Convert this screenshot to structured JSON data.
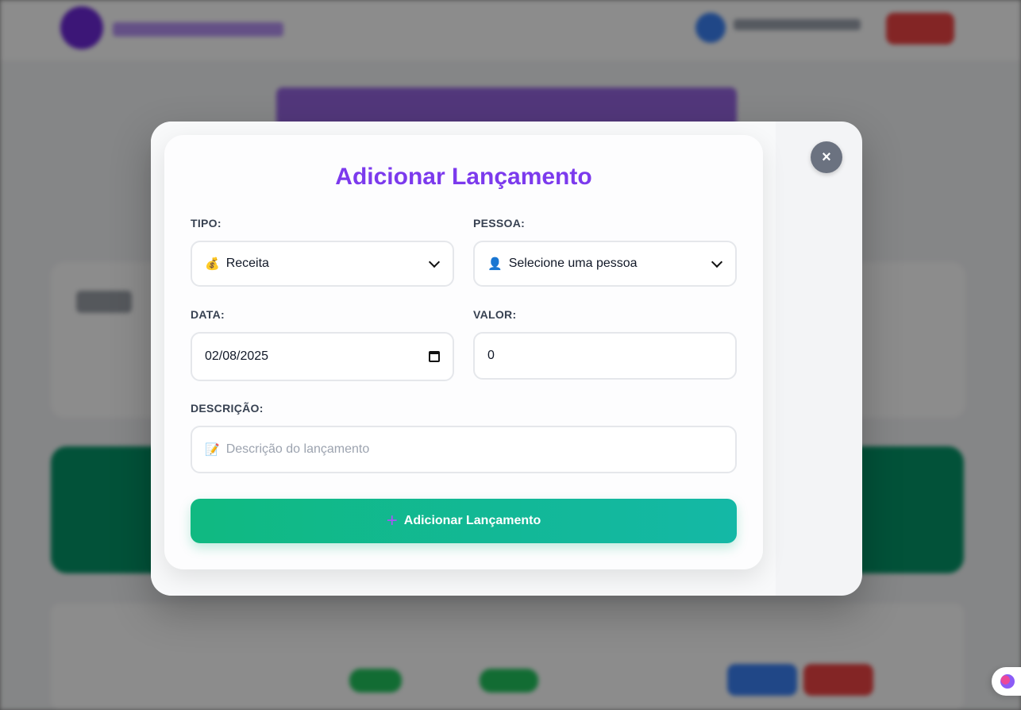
{
  "modal": {
    "title": "Adicionar Lançamento",
    "close_label": "×"
  },
  "form": {
    "tipo": {
      "label": "TIPO:",
      "icon": "💰",
      "value": "Receita"
    },
    "pessoa": {
      "label": "PESSOA:",
      "icon": "👤",
      "value": "Selecione uma pessoa"
    },
    "data": {
      "label": "DATA:",
      "value": "02/08/2025"
    },
    "valor": {
      "label": "VALOR:",
      "value": "0"
    },
    "descricao": {
      "label": "DESCRIÇÃO:",
      "icon": "📝",
      "placeholder": "Descrição do lançamento"
    },
    "submit": {
      "icon": "+",
      "label": "Adicionar Lançamento"
    }
  },
  "colors": {
    "accent": "#7c3aed",
    "submit_start": "#10b981",
    "submit_end": "#14b8a6",
    "close_bg": "#6b7280"
  }
}
